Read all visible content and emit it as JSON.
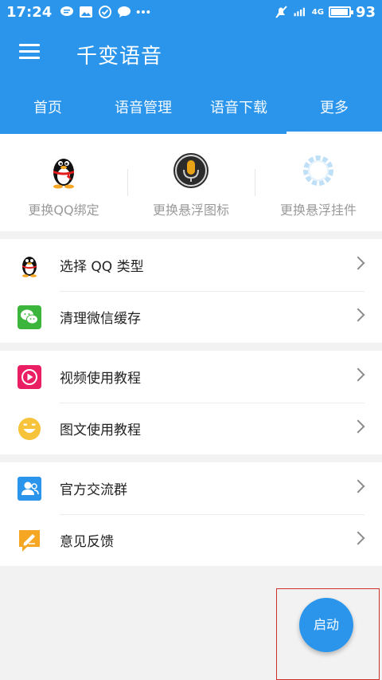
{
  "statusbar": {
    "time": "17:24",
    "network": "4G",
    "battery": "93"
  },
  "app": {
    "title": "千变语音"
  },
  "tabs": [
    {
      "label": "首页"
    },
    {
      "label": "语音管理"
    },
    {
      "label": "语音下载"
    },
    {
      "label": "更多"
    }
  ],
  "quick_actions": [
    {
      "label": "更换QQ绑定",
      "icon": "qq-penguin-icon"
    },
    {
      "label": "更换悬浮图标",
      "icon": "microphone-icon"
    },
    {
      "label": "更换悬浮挂件",
      "icon": "wreath-icon"
    }
  ],
  "menu_groups": [
    [
      {
        "label": "选择 QQ 类型",
        "icon": "qq-penguin-icon"
      },
      {
        "label": "清理微信缓存",
        "icon": "wechat-icon"
      }
    ],
    [
      {
        "label": "视频使用教程",
        "icon": "play-icon"
      },
      {
        "label": "图文使用教程",
        "icon": "smile-icon"
      }
    ],
    [
      {
        "label": "官方交流群",
        "icon": "group-icon"
      },
      {
        "label": "意见反馈",
        "icon": "pencil-icon"
      }
    ]
  ],
  "start_button": {
    "label": "启动"
  },
  "colors": {
    "primary": "#2a95ea",
    "highlight_border": "#d0302b",
    "wechat": "#3bb53b",
    "video": "#e91e63",
    "smile": "#f6c33b",
    "feedback": "#f5a623"
  }
}
